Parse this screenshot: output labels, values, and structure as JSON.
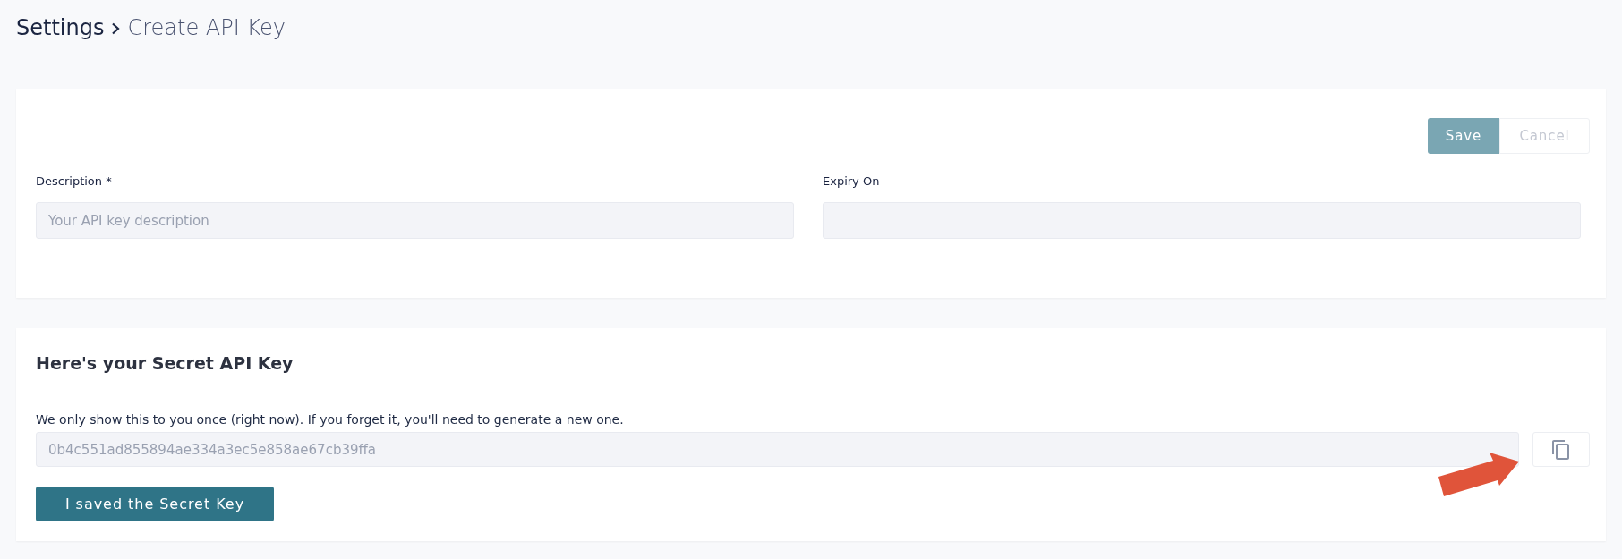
{
  "breadcrumb": {
    "parent": "Settings",
    "current": "Create API Key"
  },
  "form": {
    "actions": [
      {
        "label": "Save",
        "kind": "primary",
        "disabled": true
      },
      {
        "label": "Cancel",
        "kind": "secondary",
        "disabled": true
      }
    ],
    "fields": [
      {
        "label": "Description *",
        "placeholder": "Your API key description"
      },
      {
        "label": "Expiry On"
      }
    ]
  },
  "secret_key": {
    "title": "Here's your Secret API Key",
    "note": "We only show this to you once (right now). If you forget it, you'll need to generate a new one.",
    "value": "0b4c551ad855894ae334a3ec5e858ae67cb39ffa",
    "confirm_button": "I saved the Secret Key"
  }
}
